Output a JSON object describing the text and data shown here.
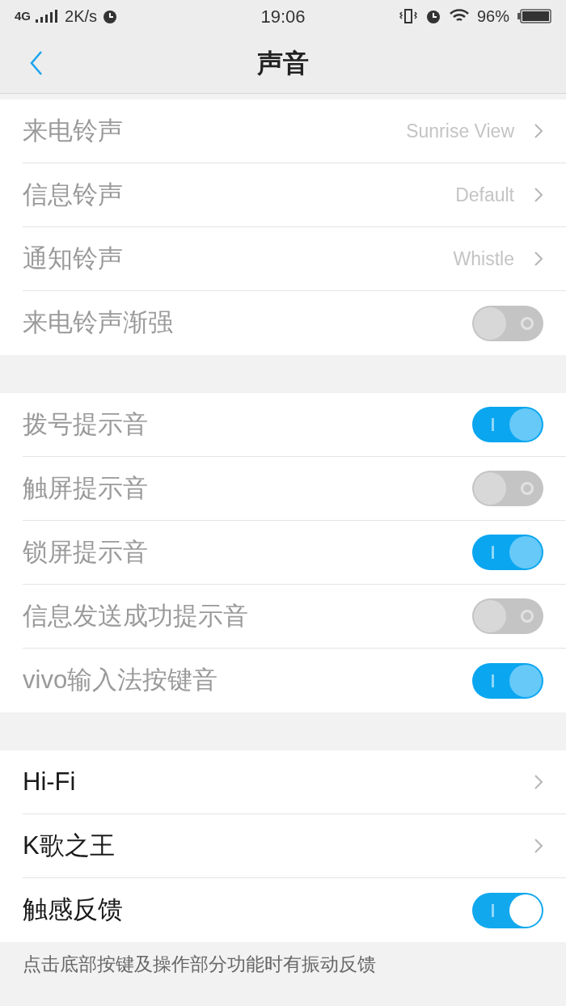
{
  "status_bar": {
    "network": "4G",
    "speed": "2K/s",
    "time": "19:06",
    "battery": "96%"
  },
  "header": {
    "title": "声音"
  },
  "groups": [
    {
      "items": [
        {
          "kind": "link",
          "label": "来电铃声",
          "value": "Sunrise View",
          "disabled": true
        },
        {
          "kind": "link",
          "label": "信息铃声",
          "value": "Default",
          "disabled": true
        },
        {
          "kind": "link",
          "label": "通知铃声",
          "value": "Whistle",
          "disabled": true
        },
        {
          "kind": "switch",
          "label": "来电铃声渐强",
          "on": false,
          "disabled": true
        }
      ]
    },
    {
      "items": [
        {
          "kind": "switch",
          "label": "拨号提示音",
          "on": true,
          "disabled": true
        },
        {
          "kind": "switch",
          "label": "触屏提示音",
          "on": false,
          "disabled": true
        },
        {
          "kind": "switch",
          "label": "锁屏提示音",
          "on": true,
          "disabled": true
        },
        {
          "kind": "switch",
          "label": "信息发送成功提示音",
          "on": false,
          "disabled": true
        },
        {
          "kind": "switch",
          "label": "vivo输入法按键音",
          "on": true,
          "disabled": true
        }
      ]
    },
    {
      "items": [
        {
          "kind": "link",
          "label": "Hi-Fi",
          "disabled": false
        },
        {
          "kind": "link",
          "label": "K歌之王",
          "disabled": false
        },
        {
          "kind": "switch",
          "label": "触感反馈",
          "on": true,
          "disabled": false
        }
      ],
      "note": "点击底部按键及操作部分功能时有振动反馈"
    }
  ]
}
